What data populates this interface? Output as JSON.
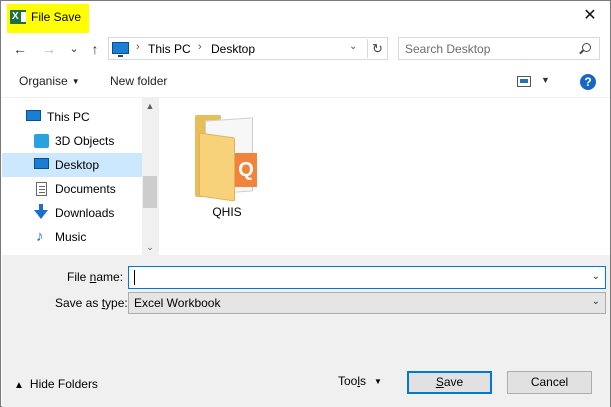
{
  "window": {
    "title": "File Save",
    "close_glyph": "✕"
  },
  "nav": {
    "back_glyph": "←",
    "forward_glyph": "→",
    "recent_glyph": "⌄",
    "up_glyph": "↑",
    "breadcrumbs": [
      "This PC",
      "Desktop"
    ],
    "refresh_glyph": "↻",
    "search_placeholder": "Search Desktop"
  },
  "toolbar": {
    "organise_label": "Organise",
    "new_folder_label": "New folder",
    "help_label": "?"
  },
  "sidebar": {
    "items": [
      {
        "label": "This PC",
        "icon": "computer-icon"
      },
      {
        "label": "3D Objects",
        "icon": "cube-icon"
      },
      {
        "label": "Desktop",
        "icon": "desktop-icon",
        "selected": true
      },
      {
        "label": "Documents",
        "icon": "documents-icon"
      },
      {
        "label": "Downloads",
        "icon": "download-arrow-icon"
      },
      {
        "label": "Music",
        "icon": "music-note-icon"
      }
    ]
  },
  "content": {
    "items": [
      {
        "name": "QHIS",
        "type": "folder",
        "badge": "Q"
      }
    ]
  },
  "form": {
    "filename_label_pre": "File ",
    "filename_label_key": "n",
    "filename_label_post": "ame:",
    "filename_value": "",
    "savetype_label_pre": "Save as ",
    "savetype_label_key": "t",
    "savetype_label_post": "ype:",
    "savetype_value": "Excel Workbook"
  },
  "footer": {
    "hide_folders_label": "Hide Folders",
    "tools_label_pre": "Too",
    "tools_label_key": "l",
    "tools_label_post": "s",
    "save_label_key": "S",
    "save_label_post": "ave",
    "cancel_label": "Cancel"
  },
  "colors": {
    "title_highlight": "#ffff00",
    "selected_bg": "#cce8ff",
    "accent": "#0078d7",
    "excel_green": "#1d7044"
  }
}
